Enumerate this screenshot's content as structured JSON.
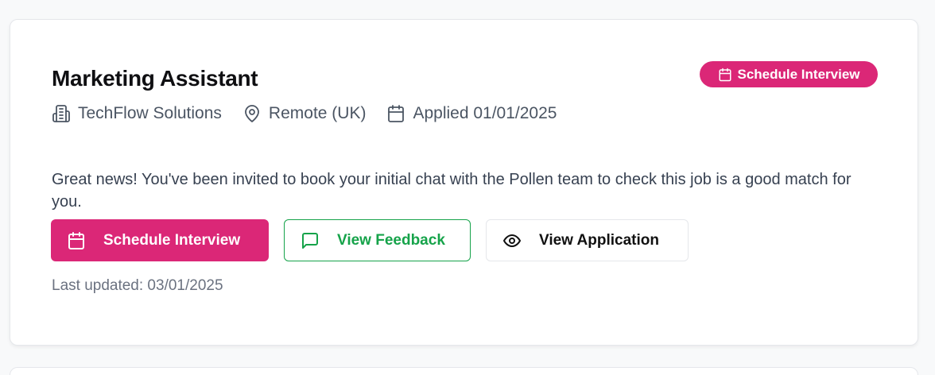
{
  "job": {
    "title": "Marketing Assistant",
    "status_badge": "Schedule Interview",
    "company": "TechFlow Solutions",
    "location": "Remote (UK)",
    "applied": "Applied 01/01/2025",
    "message": "Great news! You've been invited to book your initial chat with the Pollen team to check this job is a good match for you.",
    "last_updated": "Last updated: 03/01/2025"
  },
  "actions": {
    "schedule_label": "Schedule Interview",
    "feedback_label": "View Feedback",
    "application_label": "View Application"
  },
  "icons": {
    "company": "building-icon",
    "location": "map-pin-icon",
    "applied": "calendar-icon",
    "schedule": "calendar-icon",
    "feedback": "message-square-icon",
    "application": "eye-icon"
  },
  "colors": {
    "accent": "#db2777",
    "feedback": "#16a34a",
    "text_muted": "#4b5563"
  }
}
